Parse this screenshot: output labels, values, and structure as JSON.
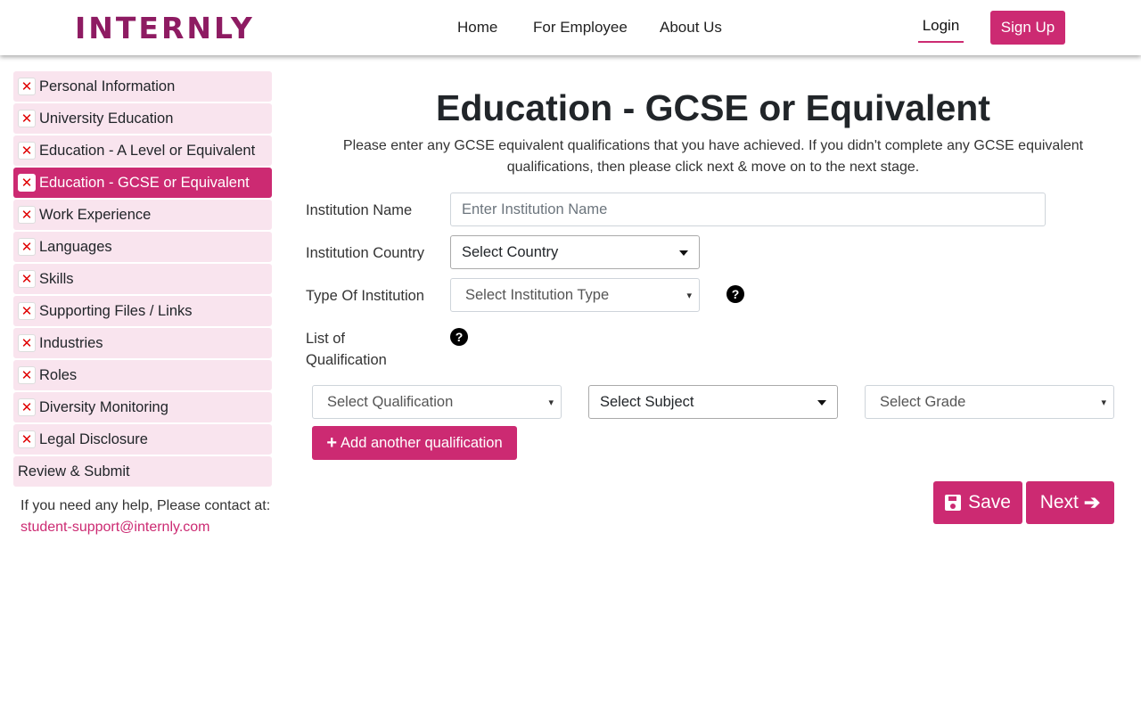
{
  "header": {
    "logo": "INTERNLY",
    "nav": [
      "Home",
      "For Employee",
      "About Us"
    ],
    "login": "Login",
    "signup": "Sign Up"
  },
  "sidebar": {
    "items": [
      {
        "label": "Personal Information",
        "icon": "x-icon"
      },
      {
        "label": "University Education",
        "icon": "x-icon"
      },
      {
        "label": "Education - A Level or Equivalent",
        "icon": "x-icon"
      },
      {
        "label": "Education - GCSE or Equivalent",
        "icon": "x-icon",
        "active": true
      },
      {
        "label": "Work Experience",
        "icon": "x-icon"
      },
      {
        "label": "Languages",
        "icon": "x-icon"
      },
      {
        "label": "Skills",
        "icon": "x-icon"
      },
      {
        "label": "Supporting Files / Links",
        "icon": "x-icon"
      },
      {
        "label": "Industries",
        "icon": "x-icon"
      },
      {
        "label": "Roles",
        "icon": "x-icon"
      },
      {
        "label": "Diversity Monitoring",
        "icon": "x-icon"
      },
      {
        "label": "Legal Disclosure",
        "icon": "x-icon"
      },
      {
        "label": "Review & Submit"
      }
    ],
    "help_text": "If you need any help, Please contact at:",
    "help_email": "student-support@internly.com"
  },
  "main": {
    "title": "Education - GCSE or Equivalent",
    "subtitle": "Please enter any GCSE equivalent qualifications that you have achieved. If you didn't complete any GCSE equivalent qualifications, then please click next & move on to the next stage.",
    "institution_name_label": "Institution Name",
    "institution_name_placeholder": "Enter Institution Name",
    "institution_country_label": "Institution Country",
    "institution_country_value": "Select Country",
    "institution_type_label": "Type Of Institution",
    "institution_type_value": "Select Institution Type",
    "qualification_list_label": "List of Qualification",
    "qualification_select": "Select Qualification",
    "subject_select": "Select Subject",
    "grade_select": "Select Grade",
    "add_button": "Add another qualification",
    "save_button": "Save",
    "next_button": "Next"
  },
  "colors": {
    "brand": "#cc2a72",
    "logo": "#8e1b62",
    "sidebar_bg": "#f9e4ee",
    "error_icon": "#e00000"
  }
}
